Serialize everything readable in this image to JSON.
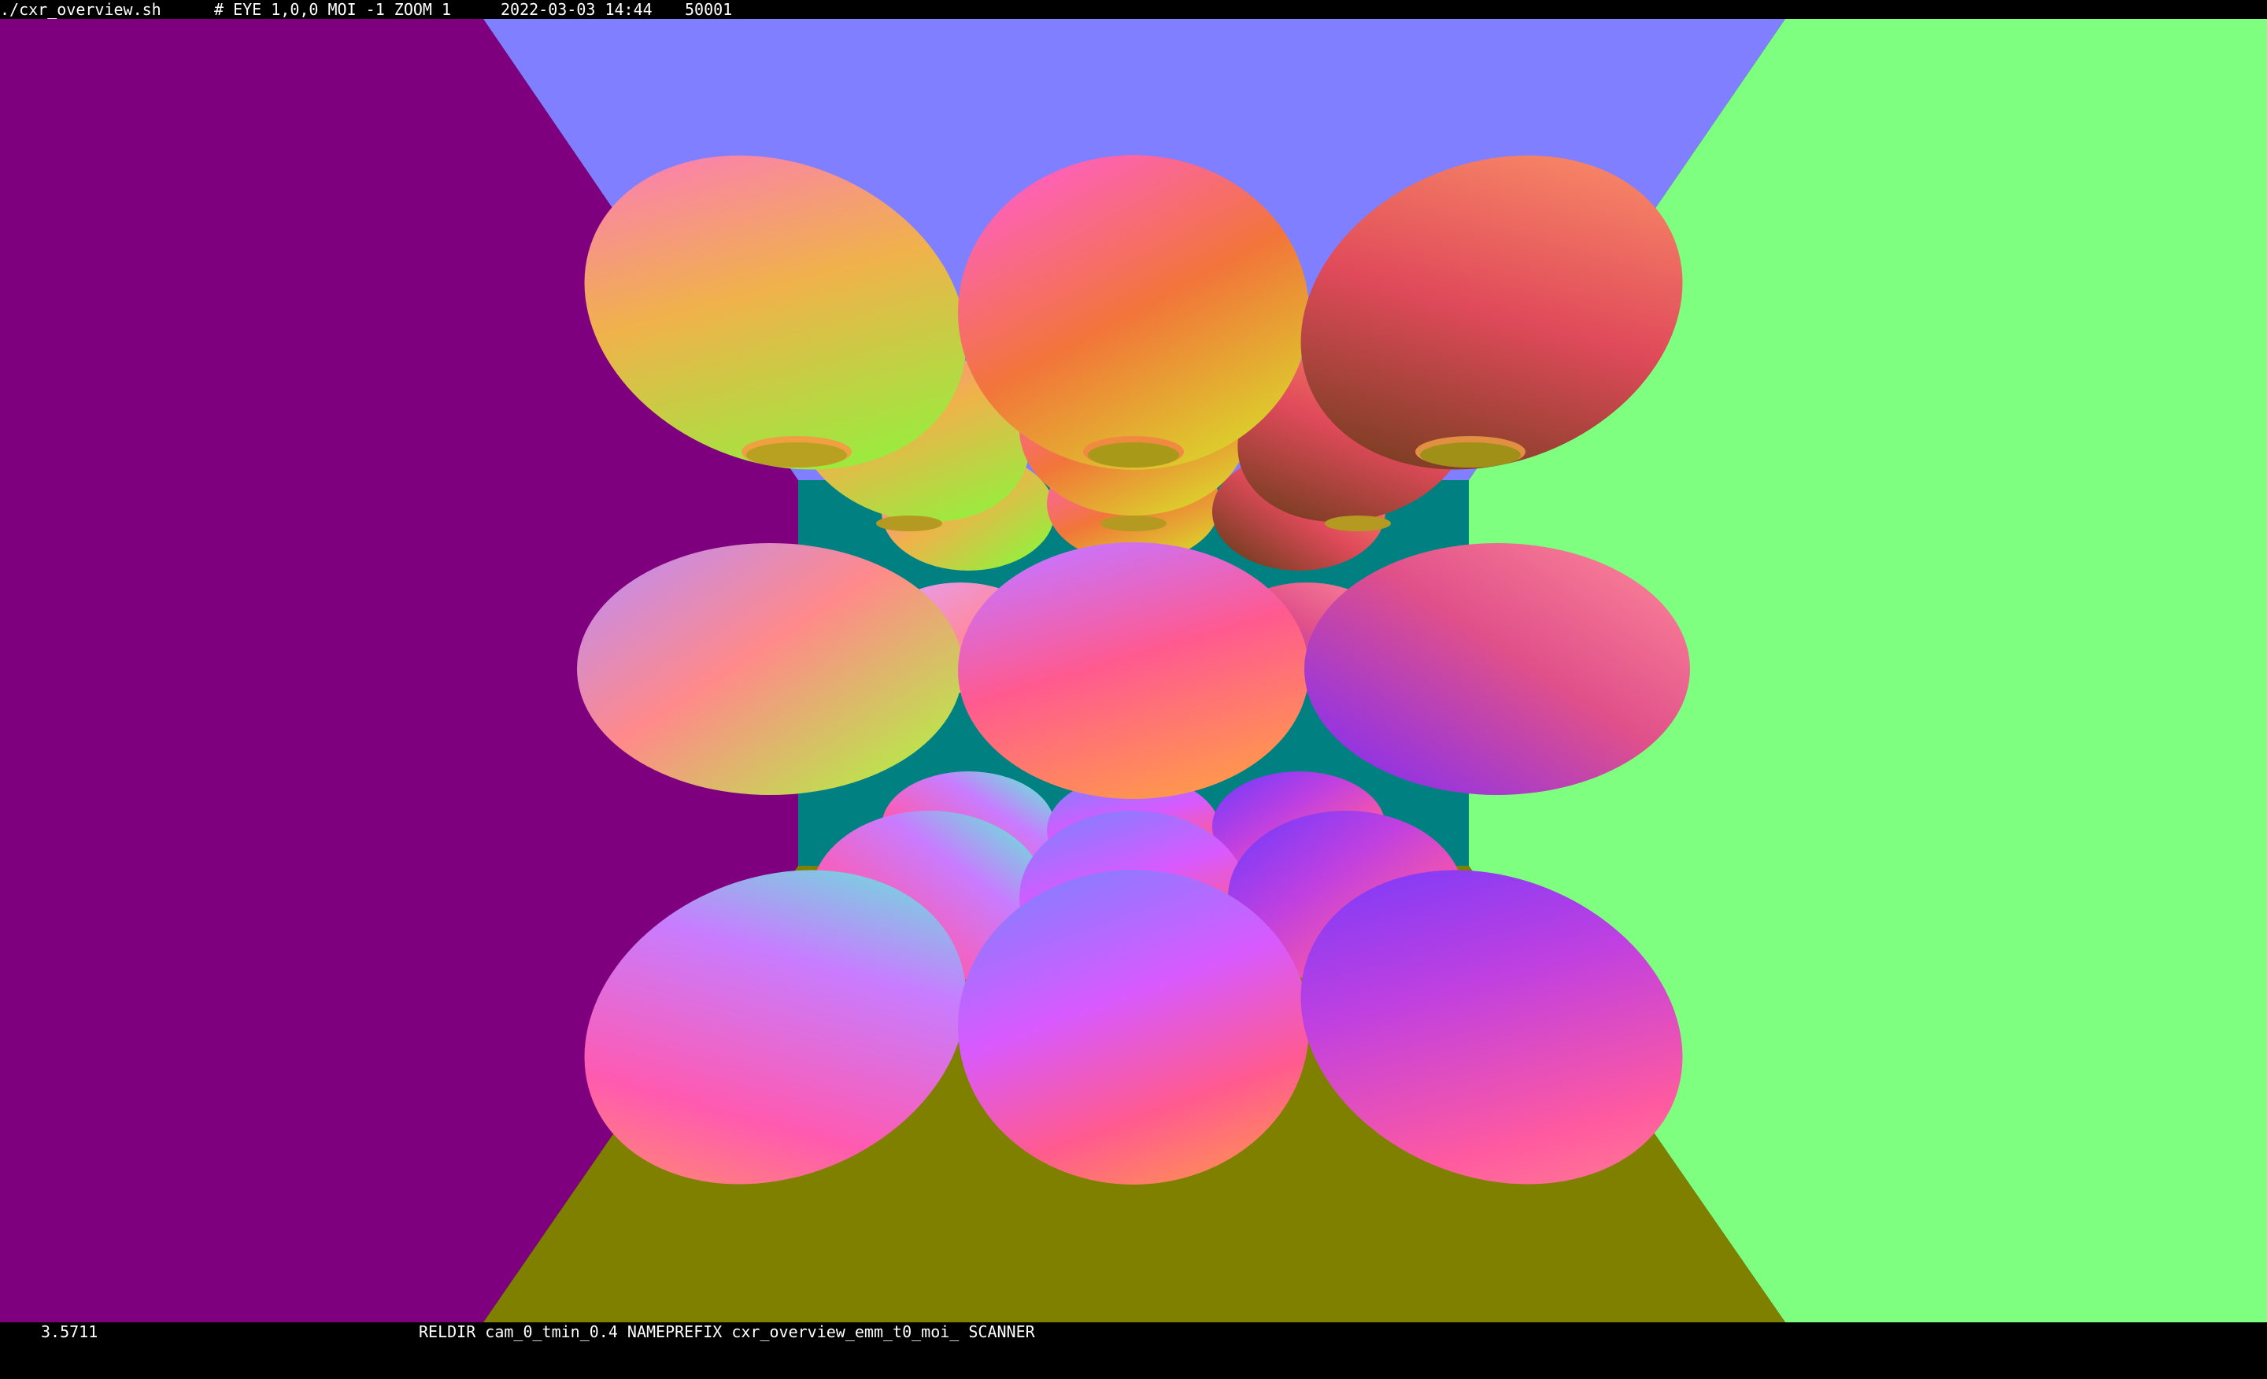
{
  "header": {
    "script": "./cxr_overview.sh",
    "params": "# EYE 1,0,0 MOI -1 ZOOM 1",
    "datetime": "2022-03-03 14:44",
    "count": "50001"
  },
  "footer": {
    "value": "3.5711",
    "info": "RELDIR cam_0_tmin_0.4 NAMEPREFIX cxr_overview_emm_t0_moi_ SCANNER"
  },
  "colors": {
    "wall_left": "#7f007f",
    "wall_top": "#7f7fff",
    "wall_right": "#7fff7f",
    "wall_bottom": "#7f7f00",
    "back_wall": "#008080",
    "bar_bg": "#000000",
    "bar_text": "#ffffff"
  },
  "scene": {
    "render_type": "normal-shaded ellipsoid grid",
    "grid": "3 x 3 x 3"
  }
}
